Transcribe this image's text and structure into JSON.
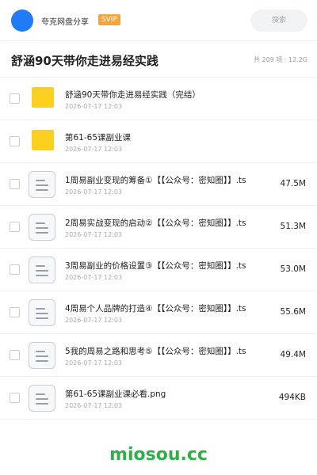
{
  "header": {
    "share_name": "夸克网盘分享",
    "badge": "SVIP",
    "search_placeholder": "搜索"
  },
  "title_bar": {
    "title": "舒涵90天带你走进易经实践",
    "summary": "共 209 项 · 12.2G"
  },
  "files": [
    {
      "type": "folder",
      "name": "舒涵90天带你走进易经实践（完结）",
      "date": "2026-07-17 12:03",
      "size": ""
    },
    {
      "type": "folder",
      "name": "第61-65课副业课",
      "date": "2026-07-17 12:03",
      "size": ""
    },
    {
      "type": "file",
      "name": "1周易副业变现的筹备①【【公众号：密知圈】】.ts",
      "date": "2026-07-17 12:03",
      "size": "47.5M"
    },
    {
      "type": "file",
      "name": "2周易实战变现的启动②【【公众号：密知圈】】.ts",
      "date": "2026-07-17 12:03",
      "size": "51.3M"
    },
    {
      "type": "file",
      "name": "3周易副业的价格设置③【【公众号：密知圈】】.ts",
      "date": "2026-07-17 12:03",
      "size": "53.0M"
    },
    {
      "type": "file",
      "name": "4周易个人品牌的打造④【【公众号：密知圈】】.ts",
      "date": "2026-07-17 12:03",
      "size": "55.6M"
    },
    {
      "type": "file",
      "name": "5我的周易之路和思考⑤【【公众号：密知圈】】.ts",
      "date": "2026-07-17 12:03",
      "size": "49.4M"
    },
    {
      "type": "file",
      "name": "第61-65课副业课必看.png",
      "date": "2026-07-17 12:03",
      "size": "494KB"
    }
  ],
  "watermark": "miosou.cc",
  "colors": {
    "avatar": "#1f7bf6",
    "svip": "#f5a33c",
    "folder": "#fbd01e",
    "watermark": "#2fae4a"
  }
}
